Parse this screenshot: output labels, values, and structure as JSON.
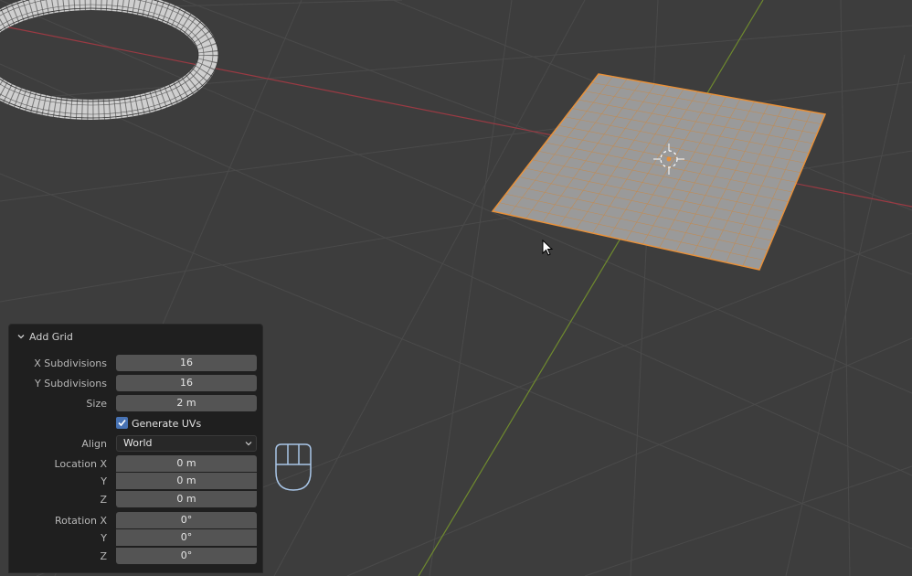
{
  "operator_panel": {
    "title": "Add Grid",
    "x_subdivisions": {
      "label": "X Subdivisions",
      "value": "16"
    },
    "y_subdivisions": {
      "label": "Y Subdivisions",
      "value": "16"
    },
    "size": {
      "label": "Size",
      "value": "2 m"
    },
    "generate_uvs": {
      "label": "Generate UVs",
      "checked": true
    },
    "align": {
      "label": "Align",
      "value": "World"
    },
    "location": {
      "label_x": "Location X",
      "label_y": "Y",
      "label_z": "Z",
      "x": "0 m",
      "y": "0 m",
      "z": "0 m"
    },
    "rotation": {
      "label_x": "Rotation X",
      "label_y": "Y",
      "label_z": "Z",
      "x": "0°",
      "y": "0°",
      "z": "0°"
    }
  },
  "viewport": {
    "objects": [
      "torus",
      "grid-plane",
      "object-origin"
    ],
    "colors": {
      "background": "#3d3d3d",
      "grid_line": "#4a4a4a",
      "x_axis": "#9a3a43",
      "y_axis": "#6f8a2e",
      "selection_outline": "#e8913a",
      "plane_fill": "#9a9a9a"
    }
  },
  "icons": [
    "chevron-down-icon",
    "checkmark-icon",
    "dropdown-caret-icon",
    "mouse-icon",
    "cursor-icon",
    "origin-icon"
  ]
}
